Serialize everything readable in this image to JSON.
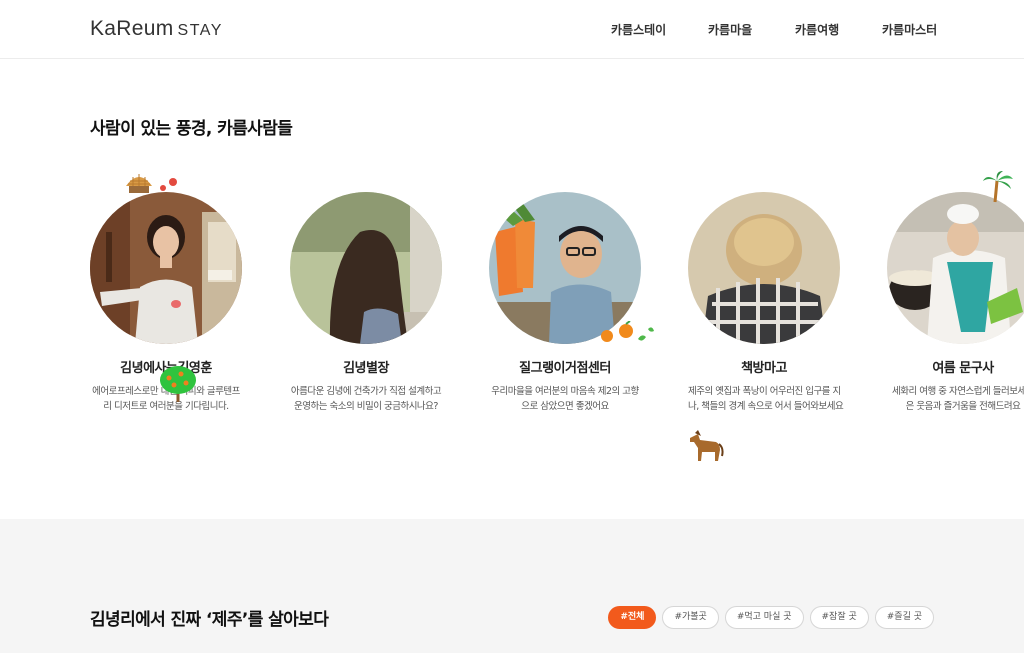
{
  "header": {
    "logo_brand": "KaReum",
    "logo_sub": "STAY",
    "nav": [
      "카름스테이",
      "카름마을",
      "카름여행",
      "카름마스터"
    ]
  },
  "people": {
    "title": "사람이 있는 풍경, 카름사람들",
    "cards": [
      {
        "name": "김녕에사는김영훈",
        "desc": [
          "에어로프레스로만 내린 커피와 글루텐프",
          "리 디저트로 여러분을 기다립니다."
        ]
      },
      {
        "name": "김녕별장",
        "desc": [
          "아름다운 김녕에 건축가가 직접 설계하고",
          "운영하는 숙소의 비밀이 궁금하시나요?"
        ]
      },
      {
        "name": "질그랭이거점센터",
        "desc": [
          "우리마을을 여러분의 마음속 제2의 고향",
          "으로 삼았으면 좋겠어요"
        ]
      },
      {
        "name": "책방마고",
        "desc": [
          "제주의 옛집과 폭낭이 어우러진 입구를 지",
          "나, 책들의 경계 속으로 어서 들어와보세요"
        ]
      },
      {
        "name": "여름 문구사",
        "desc": [
          "세화리 여행 중 자연스럽게 들러보세요",
          "은 웃음과 즐거움을 전해드려요"
        ]
      }
    ]
  },
  "live": {
    "title": "김녕리에서 진짜 ‘제주’를 살아보다",
    "filters": [
      "#전체",
      "#가볼곳",
      "#먹고 마실 곳",
      "#잠잘 곳",
      "#즐길 곳"
    ],
    "active_filter": "#전체"
  },
  "colors": {
    "accent": "#f25a1c",
    "background_gray": "#f5f5f5"
  },
  "icons": {
    "hut": "stone-hut-icon",
    "flower": "camellia-flower-icon",
    "palm": "palm-tree-icon",
    "tangerine": "tangerine-icon",
    "tree": "tangerine-tree-icon",
    "horse": "jeju-horse-icon"
  }
}
